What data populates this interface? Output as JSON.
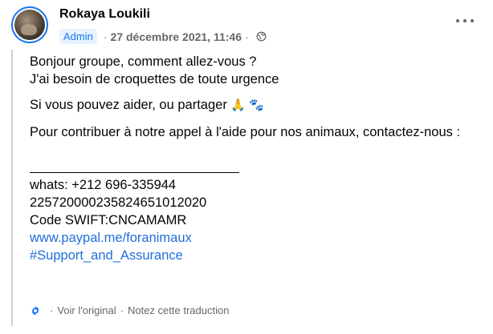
{
  "post": {
    "author_name": "Rokaya Loukili",
    "role_badge": "Admin",
    "separator": "·",
    "date": "27 décembre 2021, 11:46",
    "meta_separator": "·",
    "privacy_icon": "globe-icon",
    "more_icon": "more-options-icon"
  },
  "content": {
    "line1": "Bonjour groupe, comment allez-vous ?",
    "line2": "J'ai besoin de croquettes de toute urgence",
    "line3": "Si vous pouvez aider, ou partager",
    "line3_emojis": "🙏 🐾",
    "line4": "Pour contribuer à notre appel à l'aide pour nos animaux, contactez-nous :",
    "divider_line": "________________________________",
    "whatsapp": "whats: +212 696-335944",
    "account_number": "225720000235824651012020",
    "swift": "Code SWIFT:CNCAMAMR",
    "paypal_link": "www.paypal.me/foranimaux",
    "hashtag": "#Support_and_Assurance"
  },
  "translation": {
    "gear_icon": "gear-icon",
    "view_original": "Voir l'original",
    "dot": "·",
    "rate_translation": "Notez cette traduction"
  },
  "colors": {
    "accent": "#1877f2",
    "link": "#216fdb",
    "secondary_text": "#65676b",
    "badge_bg": "#e7f3ff"
  }
}
